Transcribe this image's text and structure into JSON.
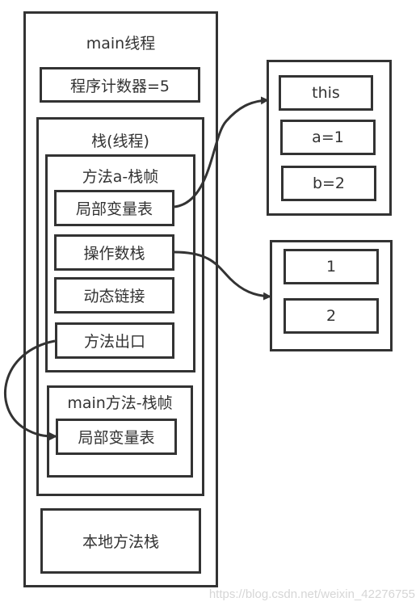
{
  "thread": {
    "title": "main线程",
    "program_counter": "程序计数器=5",
    "stack": {
      "title": "栈(线程)",
      "frame_a": {
        "title": "方法a-栈帧",
        "items": [
          "局部变量表",
          "操作数栈",
          "动态链接",
          "方法出口"
        ]
      },
      "frame_main": {
        "title": "main方法-栈帧",
        "items": [
          "局部变量表"
        ]
      }
    },
    "native_stack": "本地方法栈"
  },
  "local_vars_table": [
    "this",
    "a=1",
    "b=2"
  ],
  "operand_stack": [
    "1",
    "2"
  ],
  "arrows": [
    {
      "from": "方法a-栈帧.局部变量表",
      "to": "local_vars_table"
    },
    {
      "from": "方法a-栈帧.操作数栈",
      "to": "operand_stack"
    },
    {
      "from": "方法a-栈帧.方法出口",
      "to": "main方法-栈帧.局部变量表"
    }
  ],
  "watermark": "https://blog.csdn.net/weixin_42276755",
  "colors": {
    "stroke": "#333333",
    "background": "#ffffff",
    "watermark": "#d6d6d6"
  }
}
